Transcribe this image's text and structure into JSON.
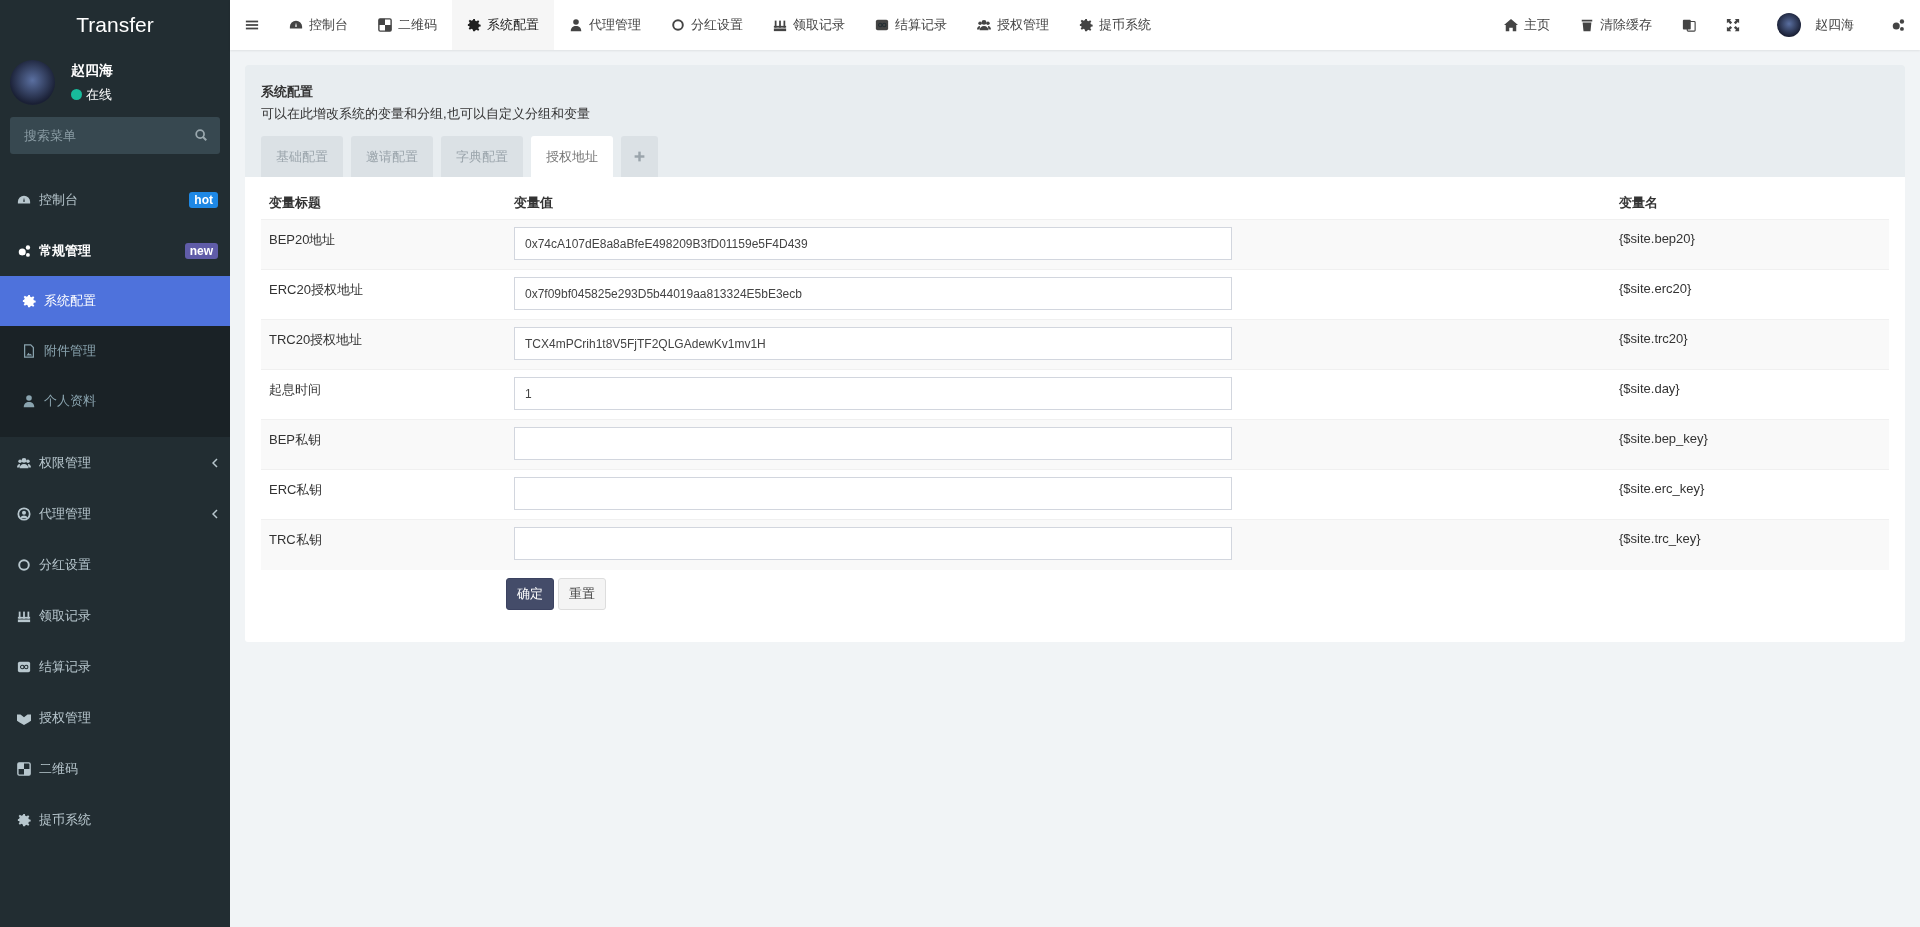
{
  "sidebar": {
    "logo": "Transfer",
    "user": {
      "name": "赵四海",
      "status": "在线",
      "online": true
    },
    "search": {
      "placeholder": "搜索菜单"
    },
    "items": [
      {
        "label": "控制台",
        "badge": "hot",
        "color": "#1e88e5"
      },
      {
        "label": "常规管理",
        "badge": "new",
        "color": "#605ca8",
        "expanded": true,
        "children": [
          {
            "label": "系统配置",
            "selected": true
          },
          {
            "label": "附件管理",
            "selected": false
          },
          {
            "label": "个人资料",
            "selected": false
          }
        ]
      },
      {
        "label": "权限管理",
        "expanded": false
      },
      {
        "label": "代理管理",
        "expanded": false
      },
      {
        "label": "分红设置"
      },
      {
        "label": "领取记录"
      },
      {
        "label": "结算记录"
      },
      {
        "label": "授权管理"
      },
      {
        "label": "二维码"
      },
      {
        "label": "提币系统"
      }
    ]
  },
  "top_nav": {
    "tabs": [
      {
        "label": "控制台",
        "selected": false
      },
      {
        "label": "二维码",
        "selected": false
      },
      {
        "label": "系统配置",
        "selected": true
      },
      {
        "label": "代理管理",
        "selected": false
      },
      {
        "label": "分红设置",
        "selected": false
      },
      {
        "label": "领取记录",
        "selected": false
      },
      {
        "label": "结算记录",
        "selected": false
      },
      {
        "label": "授权管理",
        "selected": false
      },
      {
        "label": "提币系统",
        "selected": false
      }
    ],
    "home": "主页",
    "clear_cache": "清除缓存",
    "user_name": "赵四海"
  },
  "panel": {
    "title": "系统配置",
    "description": "可以在此增改系统的变量和分组,也可以自定义分组和变量",
    "tabs": [
      {
        "label": "基础配置",
        "selected": false
      },
      {
        "label": "邀请配置",
        "selected": false
      },
      {
        "label": "字典配置",
        "selected": false
      },
      {
        "label": "授权地址",
        "selected": true
      }
    ],
    "table": {
      "columns": [
        "变量标题",
        "变量值",
        "变量名"
      ],
      "rows": [
        {
          "title": "BEP20地址",
          "value": "0x74cA107dE8a8aBfeE498209B3fD01159e5F4D439",
          "variable": "{$site.bep20}"
        },
        {
          "title": "ERC20授权地址",
          "value": "0x7f09bf045825e293D5b44019aa813324E5bE3ecb",
          "variable": "{$site.erc20}"
        },
        {
          "title": "TRC20授权地址",
          "value": "TCX4mPCrih1t8V5FjTF2QLGAdewKv1mv1H",
          "variable": "{$site.trc20}"
        },
        {
          "title": "起息时间",
          "value": "1",
          "variable": "{$site.day}"
        },
        {
          "title": "BEP私钥",
          "variable": "{$site.bep_key}"
        },
        {
          "title": "ERC私钥",
          "variable": "{$site.erc_key}"
        },
        {
          "title": "TRC私钥",
          "variable": "{$site.trc_key}"
        }
      ]
    },
    "buttons": {
      "confirm": "确定",
      "reset": "重置"
    }
  }
}
